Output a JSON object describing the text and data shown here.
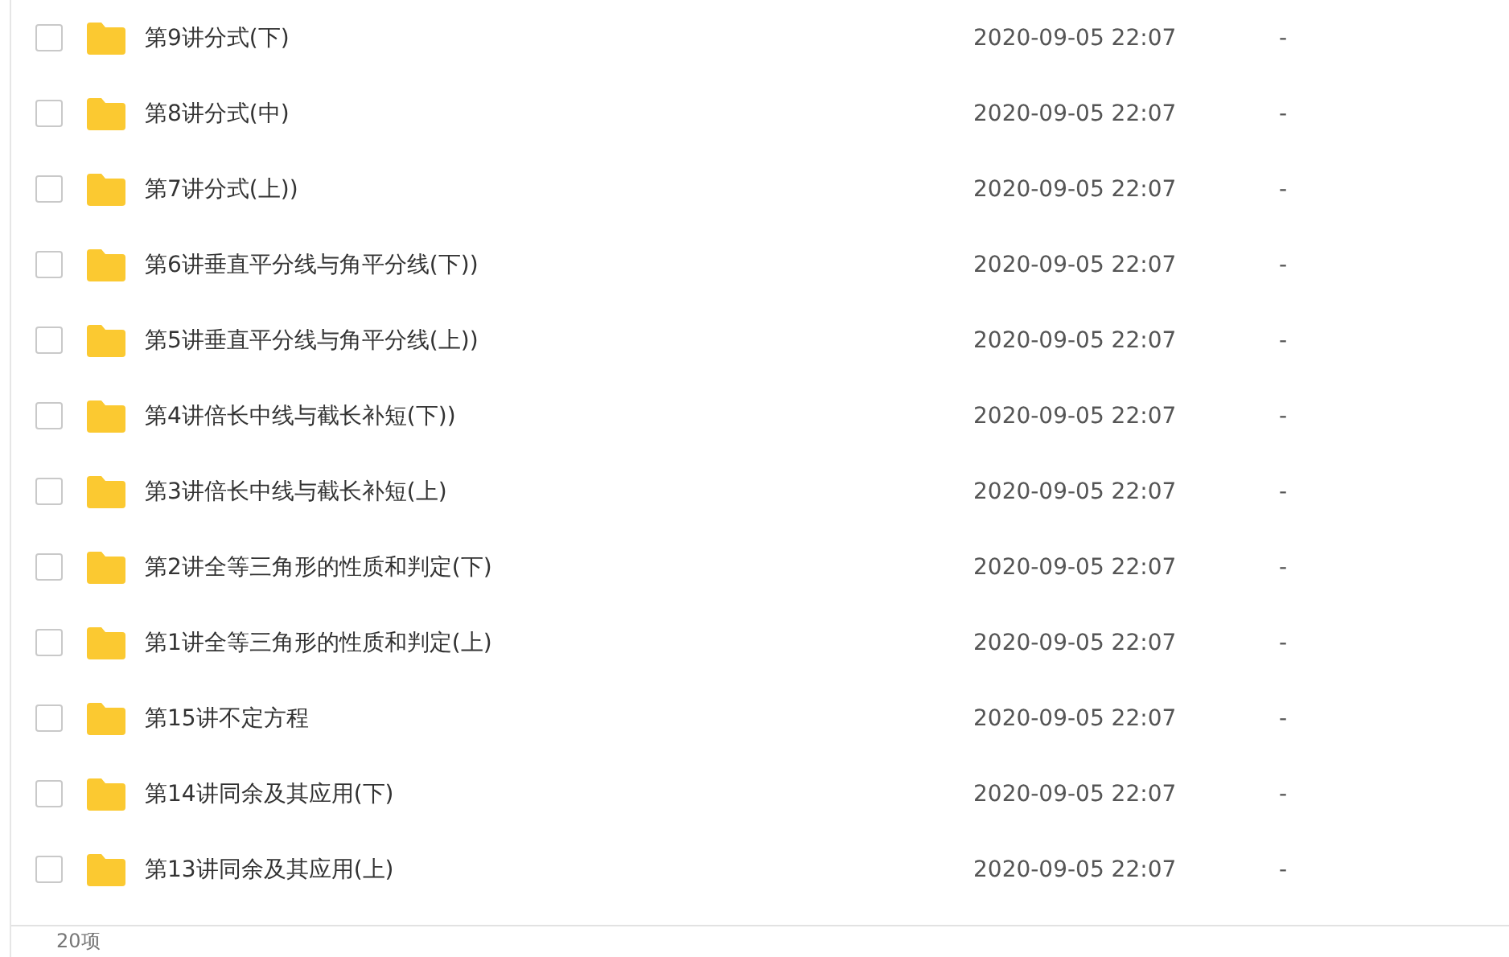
{
  "files": [
    {
      "name": "第9讲分式(下)",
      "modified": "2020-09-05 22:07",
      "size": "-",
      "checked": false
    },
    {
      "name": "第8讲分式(中)",
      "modified": "2020-09-05 22:07",
      "size": "-",
      "checked": false
    },
    {
      "name": "第7讲分式(上))",
      "modified": "2020-09-05 22:07",
      "size": "-",
      "checked": false
    },
    {
      "name": "第6讲垂直平分线与角平分线(下))",
      "modified": "2020-09-05 22:07",
      "size": "-",
      "checked": false
    },
    {
      "name": "第5讲垂直平分线与角平分线(上))",
      "modified": "2020-09-05 22:07",
      "size": "-",
      "checked": false
    },
    {
      "name": "第4讲倍长中线与截长补短(下))",
      "modified": "2020-09-05 22:07",
      "size": "-",
      "checked": false
    },
    {
      "name": "第3讲倍长中线与截长补短(上)",
      "modified": "2020-09-05 22:07",
      "size": "-",
      "checked": false
    },
    {
      "name": "第2讲全等三角形的性质和判定(下)",
      "modified": "2020-09-05 22:07",
      "size": "-",
      "checked": false
    },
    {
      "name": "第1讲全等三角形的性质和判定(上)",
      "modified": "2020-09-05 22:07",
      "size": "-",
      "checked": false
    },
    {
      "name": "第15讲不定方程",
      "modified": "2020-09-05 22:07",
      "size": "-",
      "checked": false
    },
    {
      "name": "第14讲同余及其应用(下)",
      "modified": "2020-09-05 22:07",
      "size": "-",
      "checked": false
    },
    {
      "name": "第13讲同余及其应用(上)",
      "modified": "2020-09-05 22:07",
      "size": "-",
      "checked": false
    }
  ],
  "status_bar": {
    "count": "20项"
  }
}
